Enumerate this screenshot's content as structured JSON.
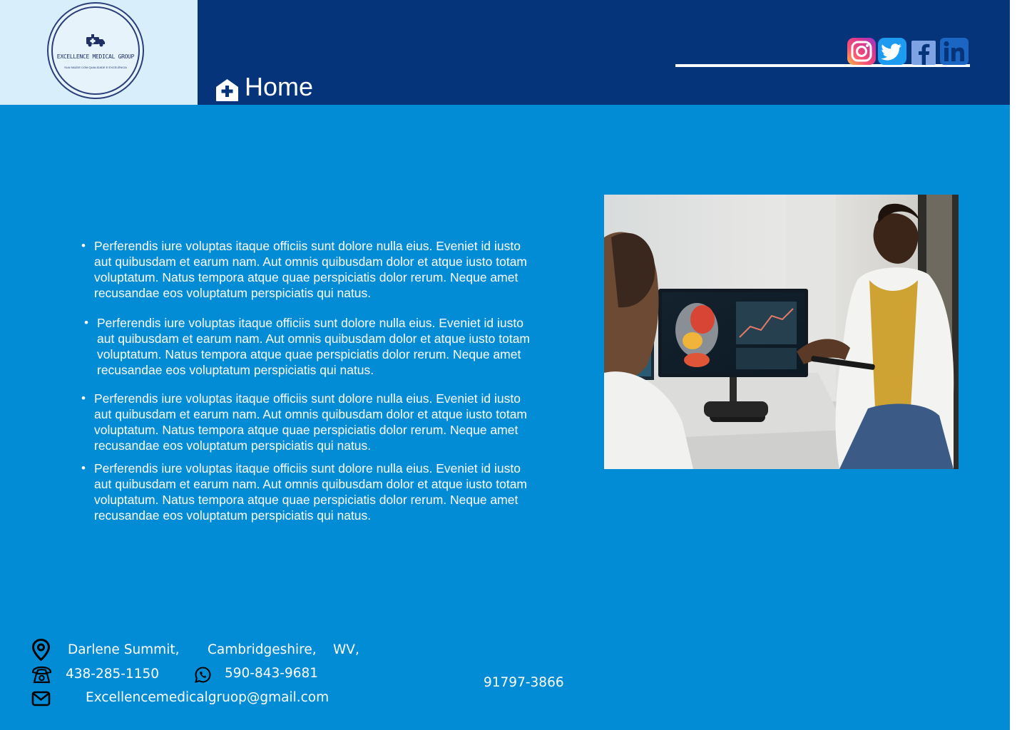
{
  "brand": {
    "logo_name": "EXCELLENCE MEDICAL GROUP",
    "logo_tagline": "SUA SAÚDE COM QUALIDADE E EXCELÊNCIA"
  },
  "nav": {
    "home_label": "Home",
    "home_icon": "house-medical-icon"
  },
  "social": [
    {
      "name": "Instagram",
      "icon": "instagram-icon"
    },
    {
      "name": "Twitter",
      "icon": "twitter-icon"
    },
    {
      "name": "Facebook",
      "icon": "facebook-icon"
    },
    {
      "name": "LinkedIn",
      "icon": "linkedin-icon"
    }
  ],
  "bullets": [
    "Perferendis iure voluptas itaque officiis sunt dolore nulla eius. Eveniet id iusto aut quibusdam et earum nam. Aut omnis quibusdam dolor et atque iusto totam voluptatum. Natus tempora atque quae perspiciatis dolor rerum. Neque amet recusandae eos voluptatum perspiciatis qui natus.",
    "Perferendis iure voluptas itaque officiis sunt dolore nulla eius. Eveniet id iusto aut quibusdam et earum nam. Aut omnis quibusdam dolor et atque iusto totam voluptatum. Natus tempora atque quae perspiciatis dolor rerum. Neque amet recusandae eos voluptatum perspiciatis qui natus.",
    "Perferendis iure voluptas itaque officiis sunt dolore nulla eius. Eveniet id iusto aut quibusdam et earum nam. Aut omnis quibusdam dolor et atque iusto totam voluptatum. Natus tempora atque quae perspiciatis dolor rerum. Neque amet recusandae eos voluptatum perspiciatis qui natus.",
    "Perferendis iure voluptas itaque officiis sunt dolore nulla eius. Eveniet id iusto aut quibusdam et earum nam. Aut omnis quibusdam dolor et atque iusto totam voluptatum. Natus tempora atque quae perspiciatis dolor rerum. Neque amet recusandae eos voluptatum perspiciatis qui natus."
  ],
  "contact": {
    "address_street": "Darlene Summit,",
    "address_city": "Cambridgeshire,",
    "address_state": "WV,",
    "phone": "438-285-1150",
    "whatsapp": "590-843-9681",
    "email": "Excellencemedicalgruop@gmail.com",
    "zip": "91797-3866"
  },
  "colors": {
    "header": "#06347b",
    "body": "#038cd6",
    "logo_panel": "#d8eefa",
    "text": "#ffffff"
  }
}
